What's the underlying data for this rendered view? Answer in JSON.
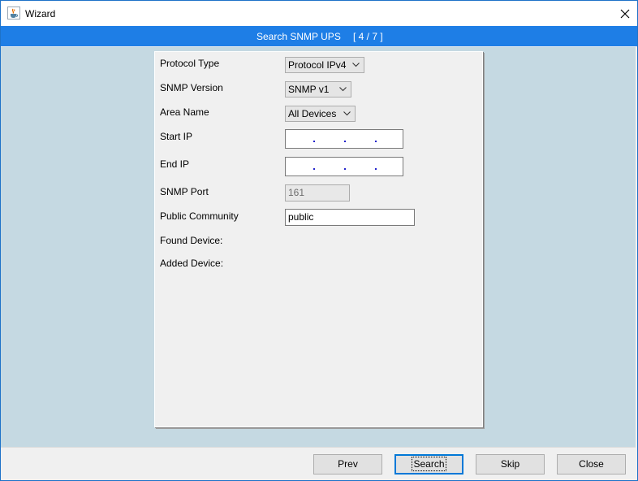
{
  "window": {
    "title": "Wizard",
    "app_icon": "java-cup-icon",
    "close_icon": "close-icon"
  },
  "banner": {
    "title": "Search SNMP UPS",
    "step": "[ 4 / 7 ]"
  },
  "form": {
    "protocol_type": {
      "label": "Protocol Type",
      "value": "Protocol IPv4"
    },
    "snmp_version": {
      "label": "SNMP Version",
      "value": "SNMP v1"
    },
    "area_name": {
      "label": "Area Name",
      "value": "All Devices"
    },
    "start_ip": {
      "label": "Start IP",
      "value": ""
    },
    "end_ip": {
      "label": "End IP",
      "value": ""
    },
    "snmp_port": {
      "label": "SNMP Port",
      "value": "161"
    },
    "public_community": {
      "label": "Public Community",
      "value": "public"
    },
    "found_device": {
      "label": "Found Device:"
    },
    "added_device": {
      "label": "Added Device:"
    }
  },
  "buttons": {
    "prev": "Prev",
    "search": "Search",
    "skip": "Skip",
    "close": "Close"
  },
  "colors": {
    "banner": "#1e7ee6",
    "content_background": "#c5d9e2",
    "panel": "#f0f0f0",
    "focus": "#0078d7"
  }
}
